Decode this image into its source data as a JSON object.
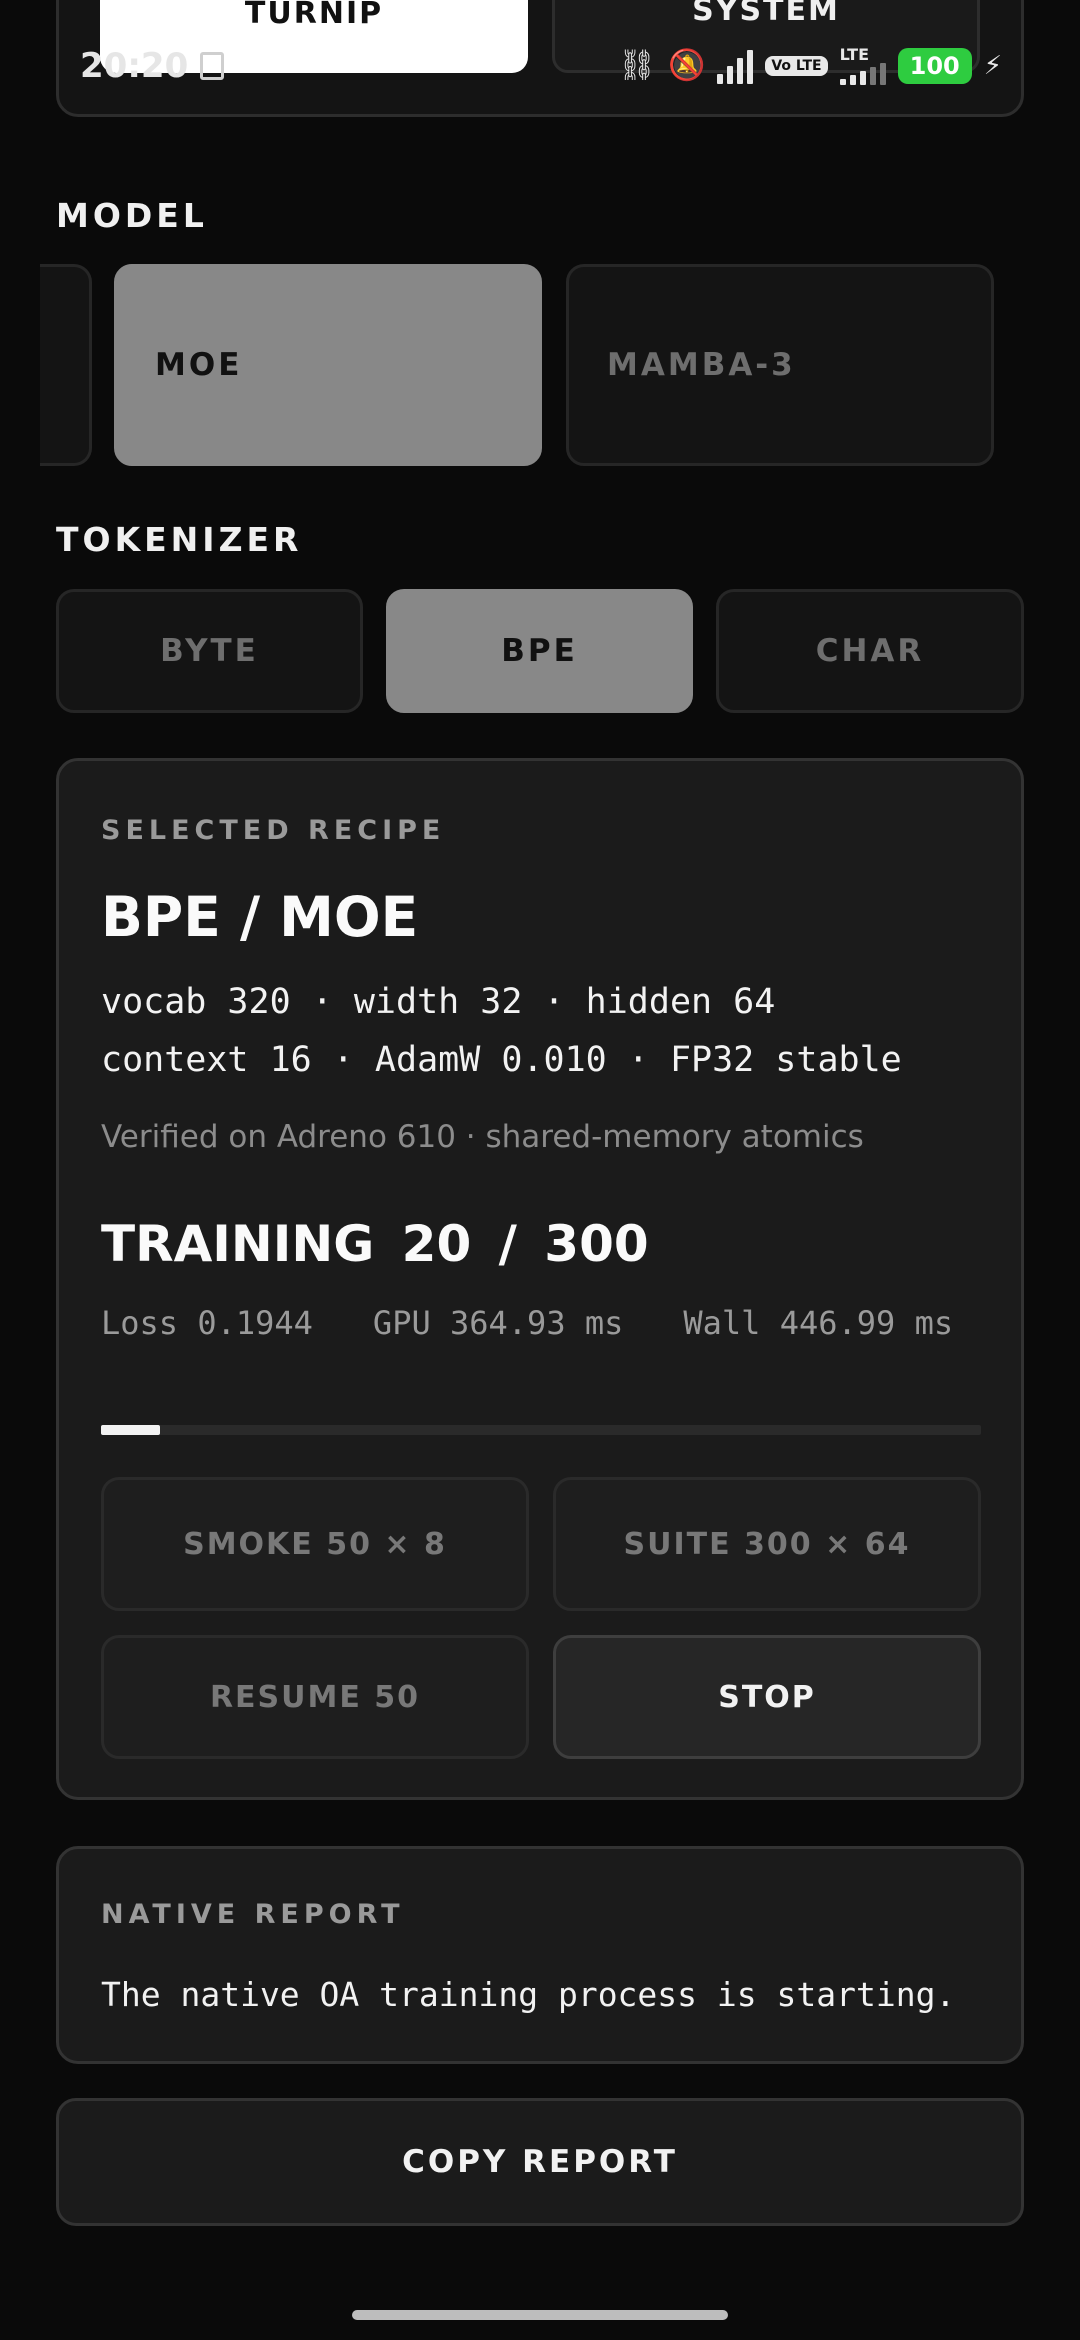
{
  "theme": {
    "options": [
      "TURNIP",
      "SYSTEM"
    ],
    "selected": "TURNIP"
  },
  "status_bar": {
    "time": "20:20",
    "icons": [
      "link-icon",
      "bell-off-icon",
      "signal-icon",
      "volte-icon",
      "lte-signal-icon"
    ],
    "volte_text": "Vo LTE",
    "lte_text": "LTE",
    "battery": "100"
  },
  "model": {
    "label": "MODEL",
    "options": [
      "MOE",
      "MAMBA-3"
    ],
    "selected": "MOE"
  },
  "tokenizer": {
    "label": "TOKENIZER",
    "options": [
      "BYTE",
      "BPE",
      "CHAR"
    ],
    "selected": "BPE"
  },
  "recipe": {
    "kicker": "SELECTED RECIPE",
    "title": "BPE / MOE",
    "spec_line1": "vocab 320 · width 32 · hidden 64",
    "spec_line2": "context 16 · AdamW 0.010 · FP32 stable",
    "note": "Verified on Adreno 610 · shared-memory atomics",
    "training_title": "TRAINING 20 / 300",
    "loss": "Loss 0.1944",
    "gpu": "GPU 364.93 ms",
    "wall": "Wall 446.99 ms",
    "progress_fraction": 0.0667,
    "actions": {
      "smoke": "SMOKE 50 × 8",
      "suite": "SUITE 300 × 64",
      "resume": "RESUME 50",
      "stop": "STOP"
    }
  },
  "report": {
    "kicker": "NATIVE REPORT",
    "text": "The native OA training process is starting.",
    "copy_label": "COPY REPORT"
  }
}
